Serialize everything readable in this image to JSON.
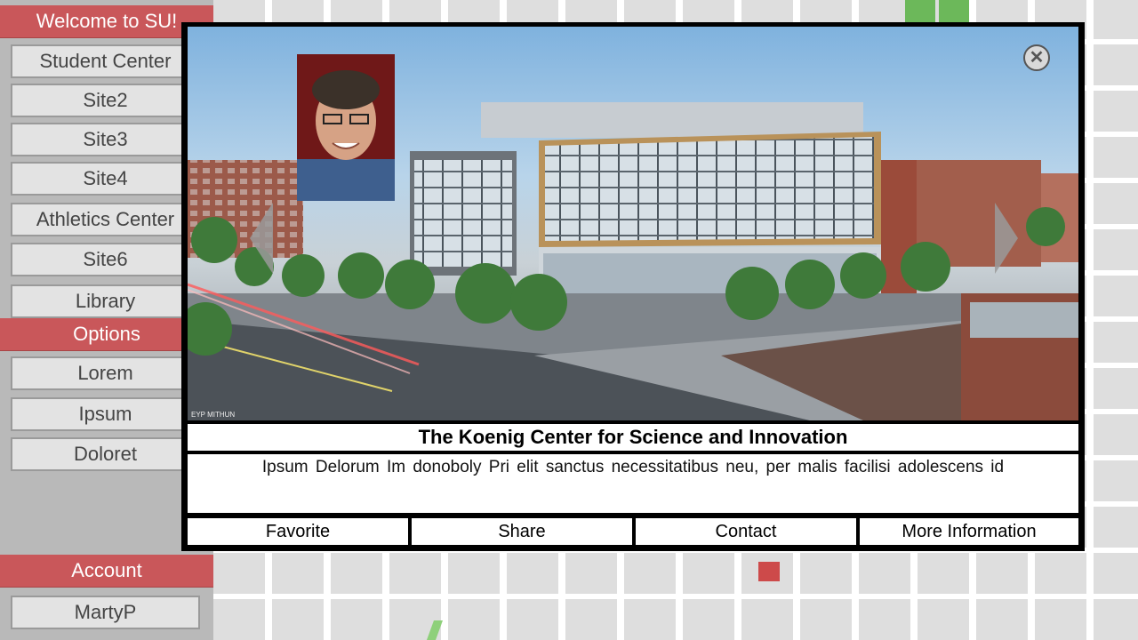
{
  "sidebar": {
    "welcome_header": "Welcome to SU!",
    "sites": [
      "Student Center",
      "Site2",
      "Site3",
      "Site4",
      "Athletics Center",
      "Site6",
      "Library"
    ],
    "options_header": "Options",
    "options": [
      "Lorem",
      "Ipsum",
      "Doloret"
    ],
    "account_header": "Account",
    "account_user": "MartyP"
  },
  "modal": {
    "title": "The Koenig Center for Science and Innovation",
    "description": "Ipsum Delorum Im donoboly Pri elit sanctus necessitatibus neu, per malis facilisi adolescens id",
    "image_credit": "EYP MITHUN",
    "close_icon": "close-icon",
    "actions": [
      "Favorite",
      "Share",
      "Contact",
      "More Information"
    ]
  },
  "colors": {
    "accent": "#c9575a",
    "sidebar_bg": "#b9b9b9",
    "button_bg": "#e3e3e3"
  }
}
